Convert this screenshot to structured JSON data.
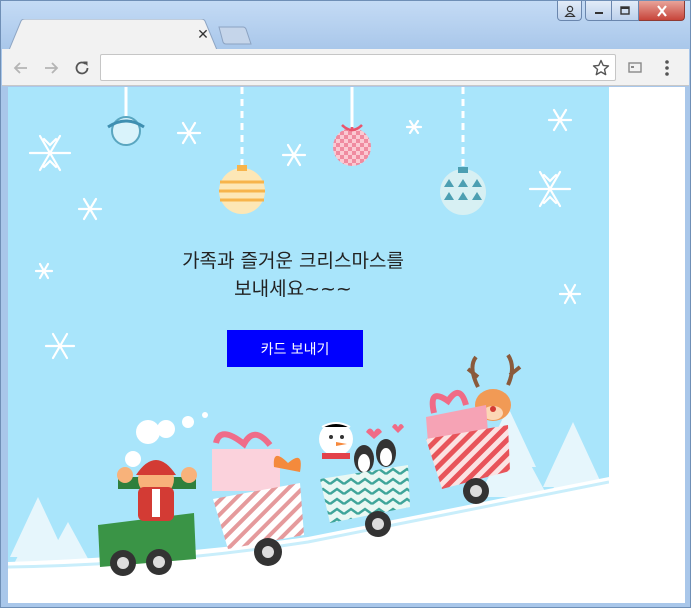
{
  "browser": {
    "tab": {
      "close_glyph": "✕"
    },
    "icons": [
      "user-icon",
      "minimize-icon",
      "maximize-icon",
      "close-icon",
      "back-icon",
      "forward-icon",
      "reload-icon",
      "star-icon",
      "cast-icon",
      "menu-icon"
    ],
    "address_value": ""
  },
  "card": {
    "greeting_line1": "가족과 즐거운 크리스마스를",
    "greeting_line2": "보내세요~~~",
    "send_button": "카드 보내기",
    "background_color": "#a9e5fb",
    "button_color": "#0000ff"
  }
}
